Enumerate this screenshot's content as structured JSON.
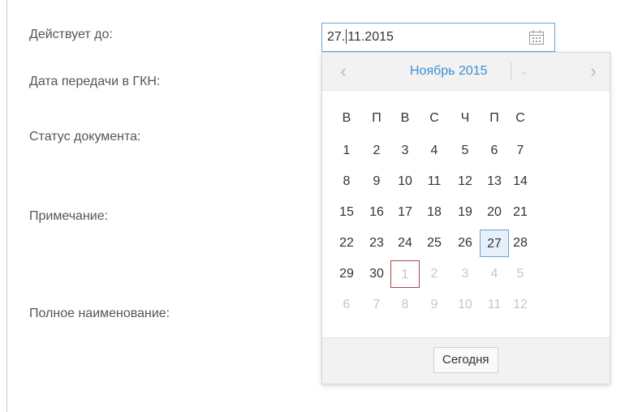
{
  "form": {
    "labels": [
      "Действует до:",
      "Дата передачи в ГКН:",
      "Статус документа:",
      "Примечание:",
      "Полное наименование:"
    ],
    "date_value_before_caret": "27.",
    "date_value_after_caret": "11.2015"
  },
  "calendar": {
    "month_title": "Ноябрь 2015",
    "prev_label": "‹",
    "next_label": "›",
    "dropdown_label": "⌄",
    "weekdays": [
      "В",
      "П",
      "В",
      "С",
      "Ч",
      "П",
      "С"
    ],
    "weeks": [
      [
        "1",
        "2",
        "3",
        "4",
        "5",
        "6",
        "7"
      ],
      [
        "8",
        "9",
        "10",
        "11",
        "12",
        "13",
        "14"
      ],
      [
        "15",
        "16",
        "17",
        "18",
        "19",
        "20",
        "21"
      ],
      [
        "22",
        "23",
        "24",
        "25",
        "26",
        "27",
        "28"
      ],
      [
        "29",
        "30",
        "1",
        "2",
        "3",
        "4",
        "5"
      ],
      [
        "6",
        "7",
        "8",
        "9",
        "10",
        "11",
        "12"
      ]
    ],
    "selected_day": "27",
    "today_label": "Сегодня"
  },
  "colors": {
    "accent": "#3a8fd6",
    "selected_bg": "#e6f0fb",
    "today_border": "#a84545"
  }
}
